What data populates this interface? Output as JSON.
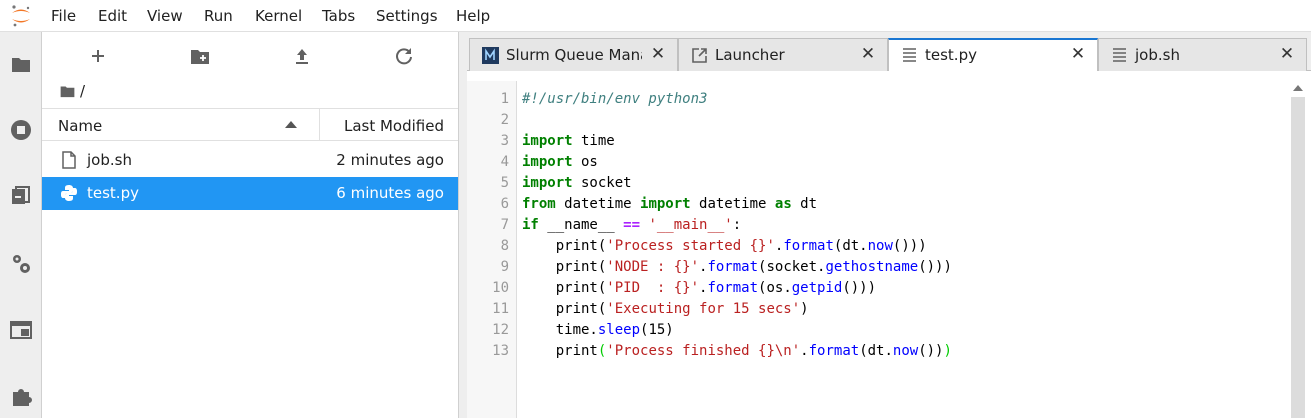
{
  "menubar": {
    "items": [
      "File",
      "Edit",
      "View",
      "Run",
      "Kernel",
      "Tabs",
      "Settings",
      "Help"
    ]
  },
  "activitybar": {
    "icons": [
      "folder-icon",
      "running-icon",
      "commands-icon",
      "property-inspector-icon",
      "tabs-icon",
      "extensions-icon"
    ]
  },
  "filebrowser": {
    "toolbar": [
      "new-launcher-icon",
      "new-folder-icon",
      "upload-icon",
      "refresh-icon"
    ],
    "breadcrumb": "/",
    "header": {
      "name": "Name",
      "modified": "Last Modified"
    },
    "files": [
      {
        "name": "job.sh",
        "modified": "2 minutes ago",
        "icon": "file-icon",
        "selected": false
      },
      {
        "name": "test.py",
        "modified": "6 minutes ago",
        "icon": "python-icon",
        "selected": true
      }
    ]
  },
  "tabs": [
    {
      "label": "Slurm Queue Manager",
      "icon": "slurm-icon",
      "active": false
    },
    {
      "label": "Launcher",
      "icon": "launcher-icon",
      "active": false
    },
    {
      "label": "test.py",
      "icon": "text-file-icon",
      "active": true
    },
    {
      "label": "job.sh",
      "icon": "text-file-icon",
      "active": false
    }
  ],
  "editor": {
    "lines": [
      "#!/usr/bin/env python3",
      "",
      "import time",
      "import os",
      "import socket",
      "from datetime import datetime as dt",
      "if __name__ == '__main__':",
      "    print('Process started {}'.format(dt.now()))",
      "    print('NODE : {}'.format(socket.gethostname()))",
      "    print('PID  : {}'.format(os.getpid()))",
      "    print('Executing for 15 secs')",
      "    time.sleep(15)",
      "    print('Process finished {}\\n'.format(dt.now()))"
    ]
  },
  "colors": {
    "accent": "#1976d2",
    "selection": "#2196f3",
    "logo": "#f37726",
    "keyword": "#008000",
    "string": "#ba2121",
    "comment": "#408080",
    "attribute": "#0000ff"
  }
}
